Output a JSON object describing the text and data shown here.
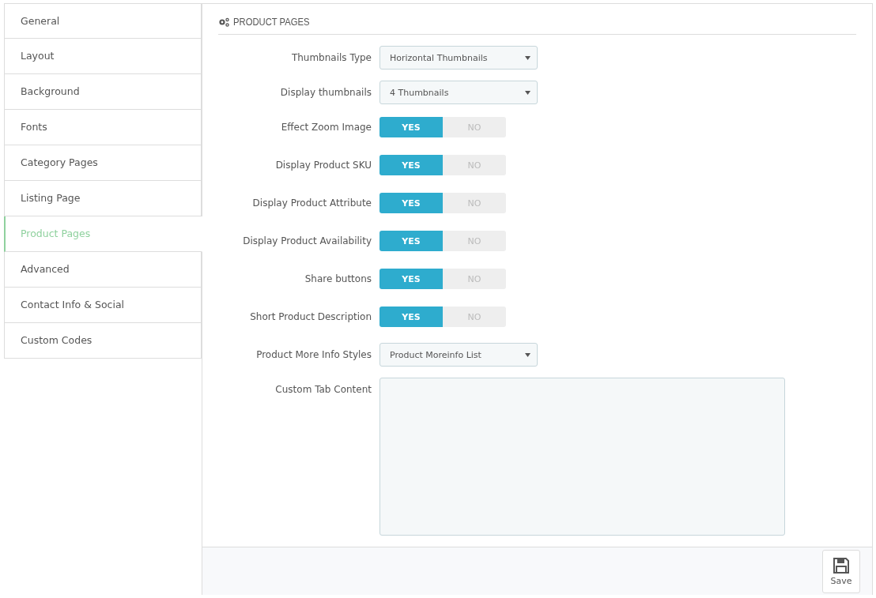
{
  "sidebar": {
    "items": [
      {
        "label": "General",
        "selected": false
      },
      {
        "label": "Layout",
        "selected": false
      },
      {
        "label": "Background",
        "selected": false
      },
      {
        "label": "Fonts",
        "selected": false
      },
      {
        "label": "Category Pages",
        "selected": false
      },
      {
        "label": "Listing Page",
        "selected": false
      },
      {
        "label": "Product Pages",
        "selected": true
      },
      {
        "label": "Advanced",
        "selected": false
      },
      {
        "label": "Contact Info & Social",
        "selected": false
      },
      {
        "label": "Custom Codes",
        "selected": false
      }
    ]
  },
  "panel": {
    "title": "PRODUCT PAGES",
    "fields": [
      {
        "kind": "select",
        "label": "Thumbnails Type",
        "value": "Horizontal Thumbnails"
      },
      {
        "kind": "select",
        "label": "Display thumbnails",
        "value": "4 Thumbnails"
      },
      {
        "kind": "toggle",
        "label": "Effect Zoom Image",
        "on": true,
        "yes": "YES",
        "no": "NO"
      },
      {
        "kind": "toggle",
        "label": "Display Product SKU",
        "on": true,
        "yes": "YES",
        "no": "NO"
      },
      {
        "kind": "toggle",
        "label": "Display Product Attribute",
        "on": true,
        "yes": "YES",
        "no": "NO"
      },
      {
        "kind": "toggle",
        "label": "Display Product Availability",
        "on": true,
        "yes": "YES",
        "no": "NO"
      },
      {
        "kind": "toggle",
        "label": "Share buttons",
        "on": true,
        "yes": "YES",
        "no": "NO"
      },
      {
        "kind": "toggle",
        "label": "Short Product Description",
        "on": true,
        "yes": "YES",
        "no": "NO"
      },
      {
        "kind": "select",
        "label": "Product More Info Styles",
        "value": "Product Moreinfo List"
      },
      {
        "kind": "textarea",
        "label": "Custom Tab Content"
      }
    ],
    "save_button": "Save"
  }
}
